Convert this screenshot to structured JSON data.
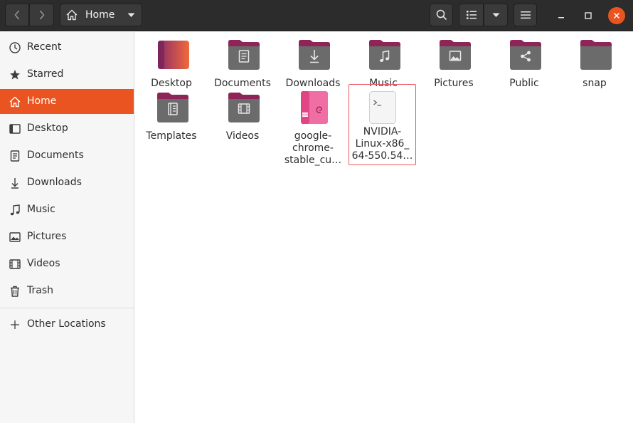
{
  "header": {
    "location": "Home",
    "buttons": {
      "back": "back",
      "forward": "forward",
      "search": "search",
      "view": "list-view",
      "view_options": "view-options",
      "menu": "menu"
    },
    "window_controls": [
      "minimize",
      "maximize",
      "close"
    ],
    "accent_close": "#e95420"
  },
  "sidebar": {
    "items": [
      {
        "label": "Recent",
        "icon": "clock-icon"
      },
      {
        "label": "Starred",
        "icon": "star-icon"
      },
      {
        "label": "Home",
        "icon": "home-icon",
        "active": true
      },
      {
        "label": "Desktop",
        "icon": "desktop-icon"
      },
      {
        "label": "Documents",
        "icon": "document-icon"
      },
      {
        "label": "Downloads",
        "icon": "download-icon"
      },
      {
        "label": "Music",
        "icon": "music-icon"
      },
      {
        "label": "Pictures",
        "icon": "picture-icon"
      },
      {
        "label": "Videos",
        "icon": "video-icon"
      },
      {
        "label": "Trash",
        "icon": "trash-icon"
      }
    ],
    "other": {
      "label": "Other Locations",
      "icon": "plus-icon"
    },
    "active_color": "#e95420"
  },
  "files": [
    {
      "name": "Desktop",
      "type": "desktop-folder"
    },
    {
      "name": "Documents",
      "type": "folder",
      "emblem": "document"
    },
    {
      "name": "Downloads",
      "type": "folder",
      "emblem": "download"
    },
    {
      "name": "Music",
      "type": "folder",
      "emblem": "music"
    },
    {
      "name": "Pictures",
      "type": "folder",
      "emblem": "picture"
    },
    {
      "name": "Public",
      "type": "folder",
      "emblem": "share"
    },
    {
      "name": "snap",
      "type": "folder",
      "emblem": "none"
    },
    {
      "name": "Templates",
      "type": "folder",
      "emblem": "template"
    },
    {
      "name": "Videos",
      "type": "folder",
      "emblem": "video"
    },
    {
      "name_lines": [
        "google-",
        "chrome-",
        "stable_cu…"
      ],
      "type": "deb-package"
    },
    {
      "name_lines": [
        "NVIDIA-",
        "Linux-x86_",
        "64-550.54…"
      ],
      "type": "script",
      "highlighted": true
    }
  ]
}
